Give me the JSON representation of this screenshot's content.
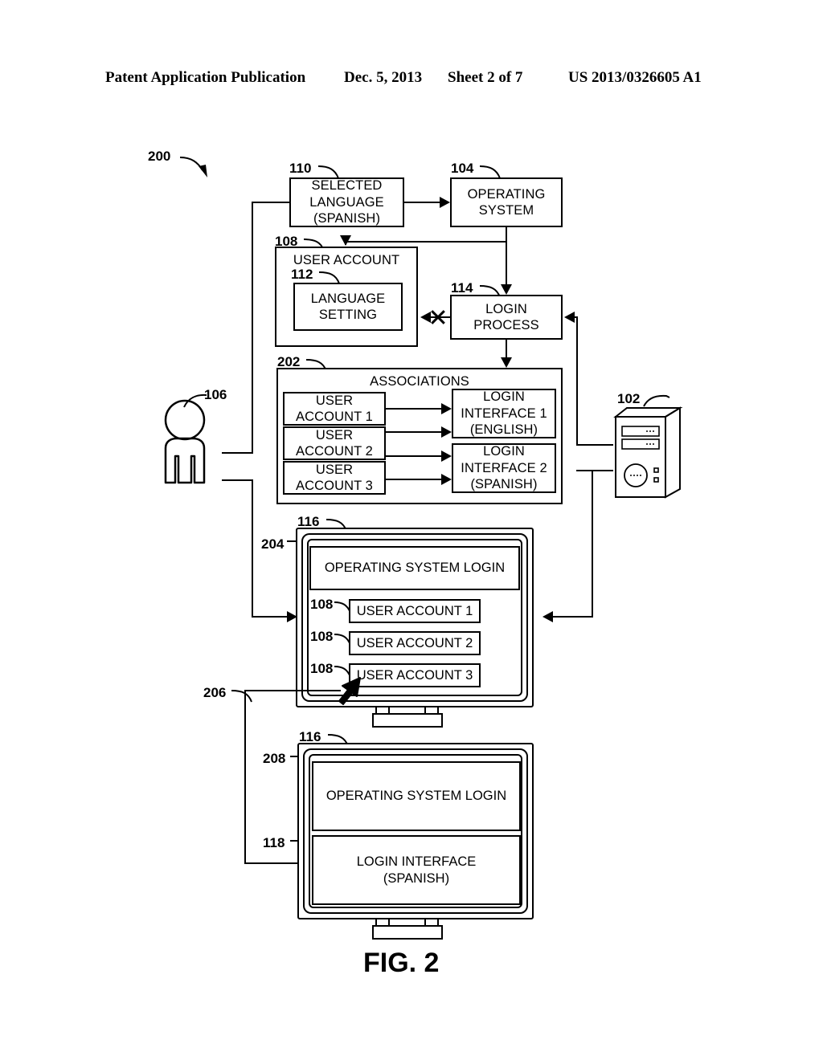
{
  "header": {
    "publication": "Patent Application Publication",
    "date": "Dec. 5, 2013",
    "sheet": "Sheet 2 of 7",
    "number": "US 2013/0326605 A1"
  },
  "figure": {
    "caption": "FIG. 2",
    "diagram_ref": "200"
  },
  "refs": {
    "system": "200",
    "computer": "102",
    "operating_system": "104",
    "user": "106",
    "user_account": "108",
    "selected_language": "110",
    "language_setting": "112",
    "login_process": "114",
    "display": "116",
    "login_interface_display": "118",
    "associations": "202",
    "account_list_screen": "204",
    "selection_flow": "206",
    "os_login_screen": "208",
    "user_account_1": "108",
    "user_account_2": "108",
    "user_account_3": "108",
    "display_2": "116"
  },
  "blocks": {
    "selected_language": "SELECTED\nLANGUAGE\n(SPANISH)",
    "selected_language_lines": [
      "SELECTED",
      "LANGUAGE",
      "(SPANISH)"
    ],
    "operating_system_lines": [
      "OPERATING",
      "SYSTEM"
    ],
    "user_account_title": "USER ACCOUNT",
    "language_setting_lines": [
      "LANGUAGE",
      "SETTING"
    ],
    "login_process_lines": [
      "LOGIN",
      "PROCESS"
    ],
    "associations_title": "ASSOCIATIONS"
  },
  "associations": {
    "title": "ASSOCIATIONS",
    "accounts": [
      {
        "lines": [
          "USER",
          "ACCOUNT 1"
        ]
      },
      {
        "lines": [
          "USER",
          "ACCOUNT 2"
        ]
      },
      {
        "lines": [
          "USER",
          "ACCOUNT 3"
        ]
      }
    ],
    "interfaces": [
      {
        "lines": [
          "LOGIN",
          "INTERFACE 1",
          "(ENGLISH)"
        ]
      },
      {
        "lines": [
          "LOGIN",
          "INTERFACE 2",
          "(SPANISH)"
        ]
      }
    ],
    "mappings": [
      {
        "from": "USER ACCOUNT 1",
        "to": "LOGIN INTERFACE 1 (ENGLISH)"
      },
      {
        "from": "USER ACCOUNT 2",
        "to": "LOGIN INTERFACE 1 (ENGLISH)"
      },
      {
        "from": "USER ACCOUNT 2",
        "to": "LOGIN INTERFACE 2 (SPANISH)"
      },
      {
        "from": "USER ACCOUNT 3",
        "to": "LOGIN INTERFACE 2 (SPANISH)"
      }
    ]
  },
  "monitor1": {
    "title": "OPERATING SYSTEM LOGIN",
    "accounts": [
      "USER ACCOUNT 1",
      "USER ACCOUNT 2",
      "USER ACCOUNT 3"
    ],
    "selected_account": "USER ACCOUNT 3"
  },
  "monitor2": {
    "title": "OPERATING SYSTEM LOGIN",
    "login_interface_lines": [
      "LOGIN INTERFACE",
      "(SPANISH)"
    ]
  },
  "icons": {
    "user": "person-icon",
    "computer": "desktop-tower-icon",
    "cursor": "mouse-pointer-icon",
    "cut_link": "x-break-icon"
  },
  "colors": {
    "ink": "#000000",
    "paper": "#ffffff"
  }
}
